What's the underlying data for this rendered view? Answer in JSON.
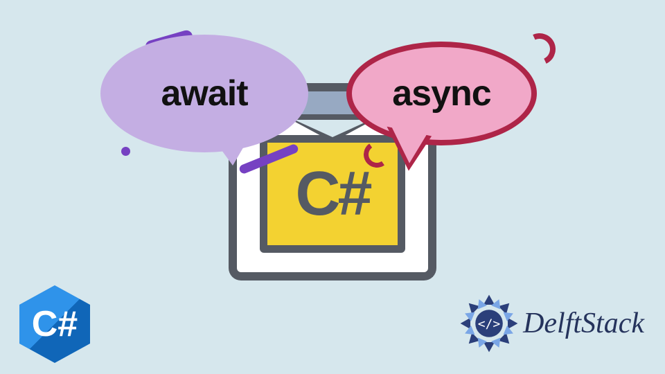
{
  "bubbles": {
    "await": "await",
    "async": "async"
  },
  "center": {
    "language_label": "C#"
  },
  "badge": {
    "text": "C#"
  },
  "brand": {
    "name": "DelftStack"
  },
  "colors": {
    "background": "#d6e7ed",
    "await_bubble": "#c4aee3",
    "await_accent": "#7641c2",
    "async_bubble": "#f1a8c8",
    "async_border": "#ae2548",
    "window_frame": "#555a63",
    "window_top": "#97a9c2",
    "yellow_box": "#f3d231",
    "cs_badge": "#1d7fd8",
    "brand_text": "#25335c"
  }
}
